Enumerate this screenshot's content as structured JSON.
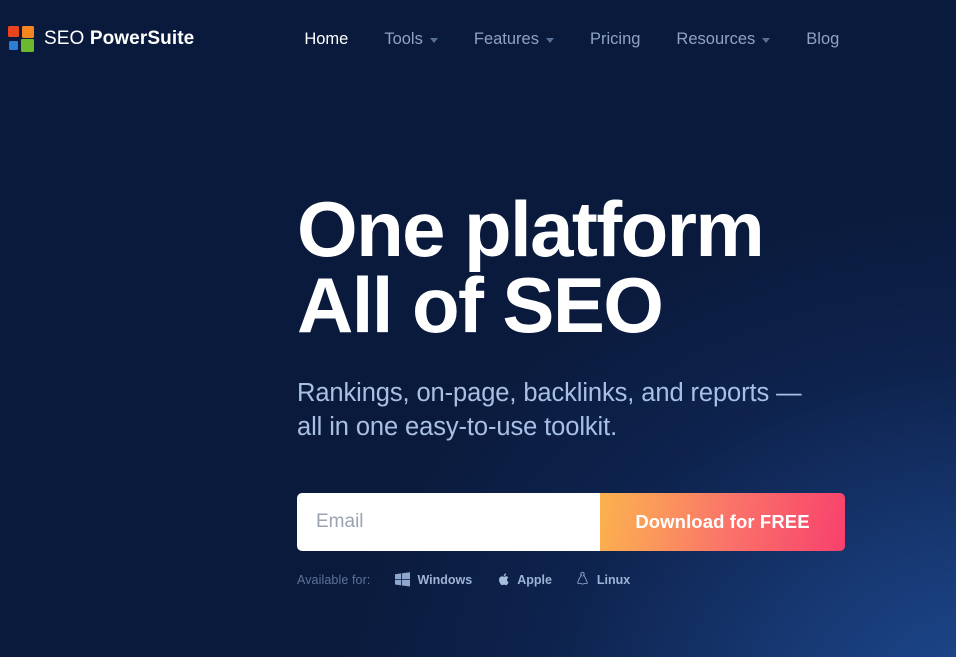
{
  "brand": {
    "name_light": "SEO",
    "name_bold": "PowerSuite",
    "logo_colors": {
      "red": "#e8451f",
      "orange": "#f5861f",
      "blue": "#2e7fd4",
      "green": "#6cb82e"
    }
  },
  "nav": {
    "items": [
      {
        "label": "Home",
        "has_dropdown": false,
        "active": true
      },
      {
        "label": "Tools",
        "has_dropdown": true,
        "active": false
      },
      {
        "label": "Features",
        "has_dropdown": true,
        "active": false
      },
      {
        "label": "Pricing",
        "has_dropdown": false,
        "active": false
      },
      {
        "label": "Resources",
        "has_dropdown": true,
        "active": false
      },
      {
        "label": "Blog",
        "has_dropdown": false,
        "active": false
      }
    ]
  },
  "hero": {
    "title_line1": "One platform",
    "title_line2": "All of SEO",
    "subtitle_line1": "Rankings, on-page, backlinks, and reports —",
    "subtitle_line2": "all in one easy-to-use toolkit."
  },
  "form": {
    "email_placeholder": "Email",
    "email_value": "",
    "submit_label": "Download for FREE",
    "button_gradient_from": "#fbb24e",
    "button_gradient_to": "#f8416d"
  },
  "availability": {
    "label": "Available for:",
    "platforms": [
      {
        "name": "Windows",
        "icon": "windows-icon"
      },
      {
        "name": "Apple",
        "icon": "apple-icon"
      },
      {
        "name": "Linux",
        "icon": "linux-tux-icon"
      }
    ]
  },
  "theme": {
    "background_dark": "#0a1a3c",
    "background_glow": "#1e4b91",
    "text_primary": "#ffffff",
    "text_muted": "#8ea3c4",
    "subtitle_color": "#a8c0e4"
  }
}
